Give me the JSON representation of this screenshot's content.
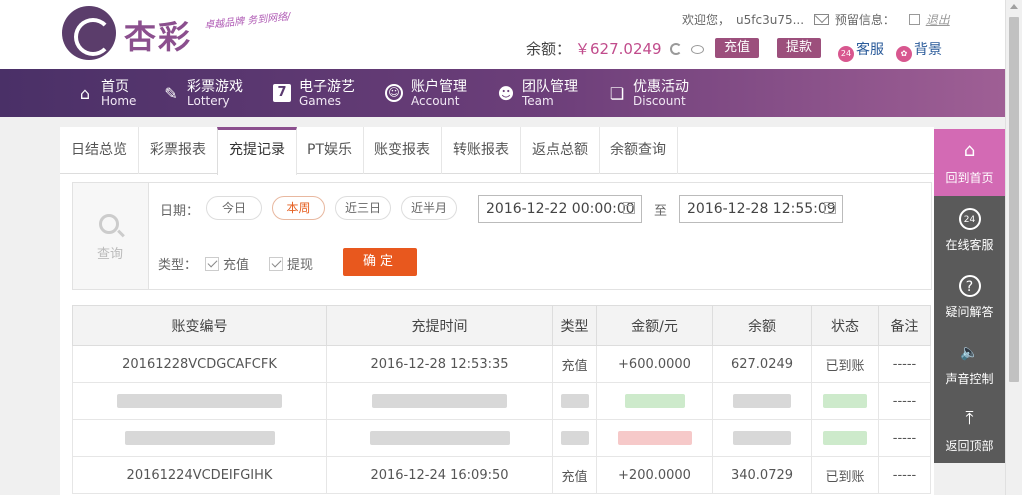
{
  "header": {
    "logo_text": "杏彩",
    "slogan": "卓越品牌 务到网络/",
    "welcome": "欢迎您，",
    "username": "u5fc3u75...",
    "reserved_info": "预留信息：",
    "logout": "退出",
    "balance_label": "余额：",
    "balance_amount": "￥627.0249",
    "deposit_btn": "充值",
    "withdraw_btn": "提款",
    "service": "客服",
    "background": "背景",
    "service_badge": "24"
  },
  "nav": [
    {
      "cn": "首页",
      "en": "Home",
      "icon": "home-icon"
    },
    {
      "cn": "彩票游戏",
      "en": "Lottery",
      "icon": "lottery-icon"
    },
    {
      "cn": "电子游艺",
      "en": "Games",
      "icon": "games-icon"
    },
    {
      "cn": "账户管理",
      "en": "Account",
      "icon": "account-icon"
    },
    {
      "cn": "团队管理",
      "en": "Team",
      "icon": "team-icon"
    },
    {
      "cn": "优惠活动",
      "en": "Discount",
      "icon": "gift-icon"
    }
  ],
  "tabs": [
    "日结总览",
    "彩票报表",
    "充提记录",
    "PT娱乐",
    "账变报表",
    "转账报表",
    "返点总额",
    "余额查询"
  ],
  "active_tab": "充提记录",
  "filter": {
    "search_label": "查询",
    "date_label": "日期：",
    "quick": [
      "今日",
      "本周",
      "近三日",
      "近半月"
    ],
    "active_quick": "本周",
    "start_date": "2016-12-22 00:00:00",
    "to": "至",
    "end_date": "2016-12-28 12:55:09",
    "type_label": "类型：",
    "type_deposit": "充值",
    "type_withdraw": "提现",
    "confirm": "确定"
  },
  "table": {
    "headers": [
      "账变编号",
      "充提时间",
      "类型",
      "金额/元",
      "余额",
      "状态",
      "备注"
    ],
    "rows": [
      {
        "id": "20161228VCDGCAFCFK",
        "time": "2016-12-28 12:53:35",
        "type": "充值",
        "amount": "+600.0000",
        "balance": "627.0249",
        "status": "已到账",
        "note": "-----"
      },
      {
        "id": "",
        "time": "",
        "type": "",
        "amount": "",
        "balance": "",
        "status": "",
        "note": "-----"
      },
      {
        "id": "",
        "time": "",
        "type": "",
        "amount": "",
        "balance": "",
        "status": "",
        "note": "-----"
      },
      {
        "id": "20161224VCDEIFGIHK",
        "time": "2016-12-24 16:09:50",
        "type": "充值",
        "amount": "+200.0000",
        "balance": "340.0729",
        "status": "已到账",
        "note": "-----"
      }
    ]
  },
  "side_tools": [
    {
      "label": "回到首页",
      "icon": "home-icon",
      "glyph": "⌂"
    },
    {
      "label": "在线客服",
      "icon": "headset-icon",
      "glyph": "24"
    },
    {
      "label": "疑问解答",
      "icon": "question-icon",
      "glyph": "?"
    },
    {
      "label": "声音控制",
      "icon": "speaker-icon",
      "glyph": "🔈"
    },
    {
      "label": "返回顶部",
      "icon": "to-top-icon",
      "glyph": "⤒"
    }
  ],
  "colors": {
    "accent": "#8b4f8e",
    "nav_start": "#4a3067",
    "nav_end": "#9f5f95",
    "confirm": "#e8581e",
    "amount": "#e33d3d",
    "status_ok": "#3aa63a"
  }
}
